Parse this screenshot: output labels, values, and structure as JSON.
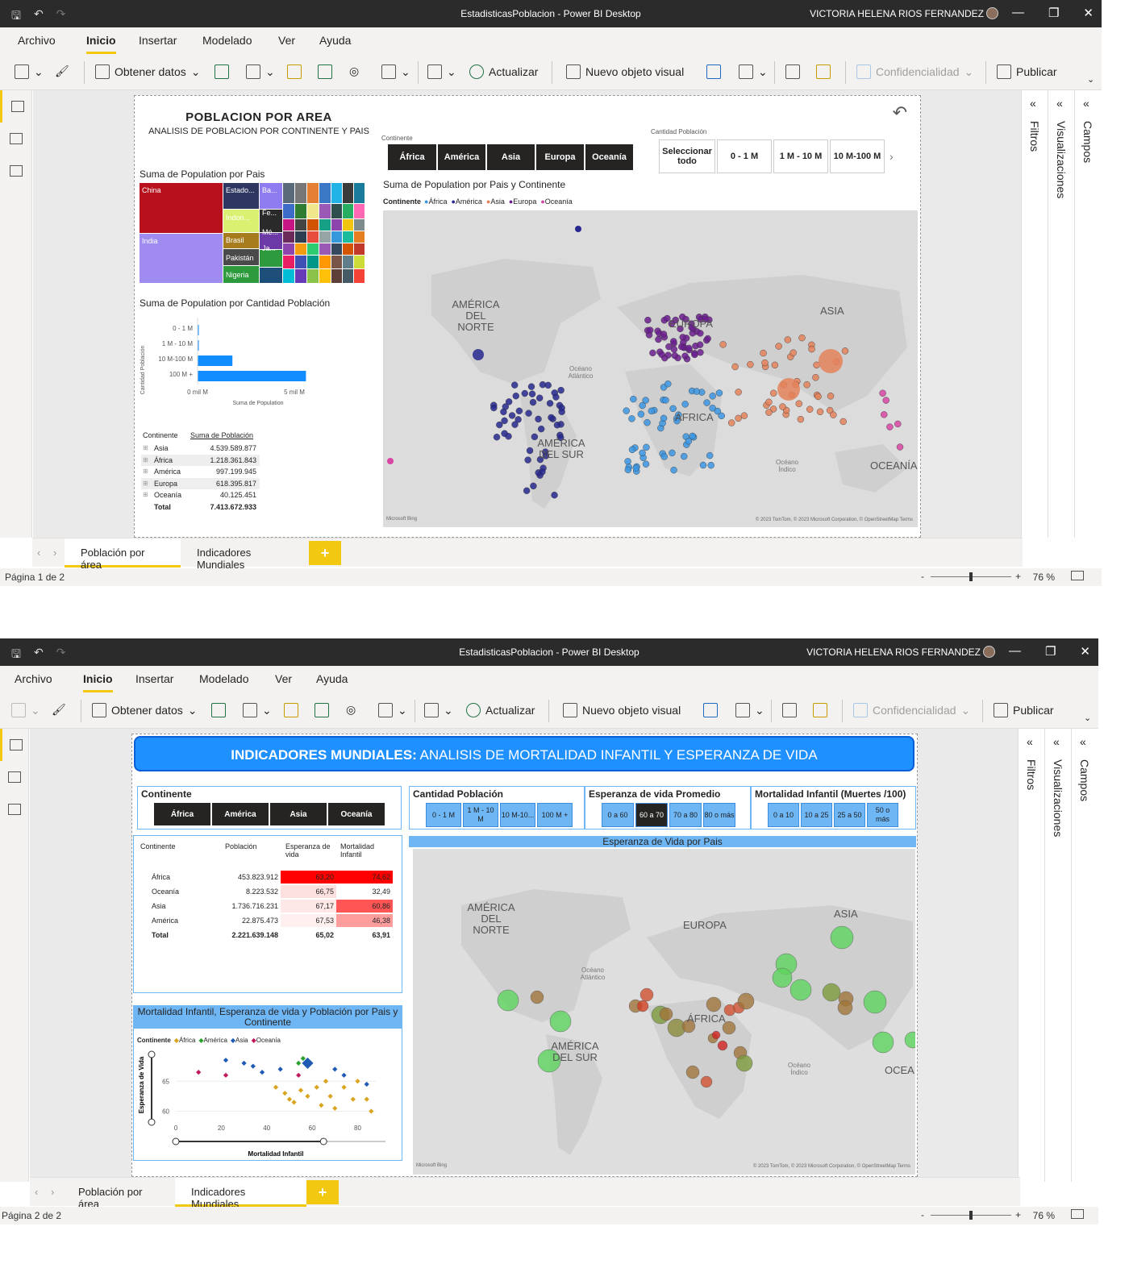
{
  "app": {
    "title": "EstadisticasPoblacion - Power BI Desktop",
    "user": "VICTORIA HELENA RIOS FERNANDEZ",
    "menu": [
      "Archivo",
      "Inicio",
      "Insertar",
      "Modelado",
      "Ver",
      "Ayuda"
    ],
    "ribbon": {
      "obtener": "Obtener datos",
      "actualizar": "Actualizar",
      "nuevo": "Nuevo objeto visual",
      "confidencialidad": "Confidencialidad",
      "publicar": "Publicar"
    },
    "panes": [
      "Filtros",
      "Visualizaciones",
      "Campos"
    ],
    "tabs": [
      "Población por área",
      "Indicadores Mundiales"
    ],
    "zoom": "76 %"
  },
  "page1": {
    "status": "Página 1 de 2",
    "title": "POBLACION POR AREA",
    "subtitle": "ANALISIS DE POBLACION POR CONTINENTE Y PAIS",
    "continent_slicer_label": "Continente",
    "continents": [
      "África",
      "América",
      "Asia",
      "Europa",
      "Oceanía"
    ],
    "cantidad_slicer_label": "Cantidad Población",
    "cantidad_options": [
      "Seleccionar todo",
      "0 - 1 M",
      "1 M - 10 M",
      "10 M-100 M"
    ],
    "treemap_title": "Suma de Population por Pais",
    "treemap_labels": [
      "China",
      "India",
      "Estado...",
      "Ba...",
      "Indon...",
      "Fe...",
      "Brasil",
      "Mé...",
      "Pakistán",
      "Ja...",
      "Nigeria"
    ],
    "bar_title": "Suma de Population por Cantidad Población",
    "bar_ylabel": "Cantidad Población",
    "bar_xlabel": "Suma de Population",
    "bar_ticks": [
      "0 mil M",
      "5 mil M"
    ],
    "map_title": "Suma de Population por Pais y Continente",
    "map_legend_label": "Continente",
    "map_labels": [
      "AMÉRICA DEL NORTE",
      "EUROPA",
      "ASIA",
      "ÁFRICA",
      "AMÉRICA DEL SUR",
      "OCEANÍA",
      "Océano Atlántico",
      "Océano Índico"
    ],
    "map_credit": "© 2023 TomTom, © 2023 Microsoft Corporation, © OpenStreetMap  Terms",
    "bing": "Microsoft Bing",
    "table_headers": [
      "Continente",
      "Suma de Población"
    ],
    "table_rows": [
      [
        "Asia",
        "4.539.589.877"
      ],
      [
        "África",
        "1.218.361.843"
      ],
      [
        "América",
        "997.199.945"
      ],
      [
        "Europa",
        "618.395.817"
      ],
      [
        "Oceanía",
        "40.125.451"
      ]
    ],
    "table_total": [
      "Total",
      "7.413.672.933"
    ]
  },
  "page2": {
    "status": "Página 2 de 2",
    "banner_bold": "INDICADORES MUNDIALES:",
    "banner_rest": " ANALISIS DE MORTALIDAD INFANTIL Y ESPERANZA DE VIDA",
    "continent_label": "Continente",
    "continents": [
      "África",
      "América",
      "Asia",
      "Oceanía"
    ],
    "cantidad_label": "Cantidad Población",
    "cantidad_options": [
      "0 - 1 M",
      "1 M - 10 M",
      "10 M-10...",
      "100 M +"
    ],
    "esperanza_label": "Esperanza de vida Promedio",
    "esperanza_options": [
      "0 a 60",
      "60 a 70",
      "70 a 80",
      "80 o más"
    ],
    "mortalidad_label": "Mortalidad Infantil (Muertes /100)",
    "mortalidad_options": [
      "0 a 10",
      "10 a 25",
      "25 a 50",
      "50 o más"
    ],
    "table_headers": [
      "Continente",
      "Población",
      "Esperanza de vida",
      "Mortalidad Infantil"
    ],
    "table_rows": [
      [
        "África",
        "453.823.912",
        "63,20",
        "74,62"
      ],
      [
        "Oceanía",
        "8.223.532",
        "66,75",
        "32,49"
      ],
      [
        "Asia",
        "1.736.716.231",
        "67,17",
        "60,86"
      ],
      [
        "América",
        "22.875.473",
        "67,53",
        "46,38"
      ]
    ],
    "table_total": [
      "Total",
      "2.221.639.148",
      "65,02",
      "63,91"
    ],
    "map_title": "Esperanza de Vida por Pais",
    "map_labels": [
      "AMÉRICA DEL NORTE",
      "EUROPA",
      "ASIA",
      "ÁFRICA",
      "AMÉRICA DEL SUR",
      "OCEA",
      "Océano Atlántico",
      "Océano Índico"
    ],
    "scatter_title": "Mortalidad Infantil, Esperanza de vida y Población por Pais y Continente",
    "scatter_legend_label": "Continente",
    "scatter_legend": [
      "África",
      "América",
      "Asia",
      "Oceanía"
    ],
    "scatter_xlabel": "Mortalidad Infantil",
    "scatter_ylabel": "Esperanza de Vida",
    "scatter_xticks": [
      "0",
      "20",
      "40",
      "60",
      "80"
    ],
    "scatter_yticks": [
      "65",
      "60"
    ]
  },
  "colors": {
    "africa": "#3b97e3",
    "america": "#27288f",
    "asia": "#e4825a",
    "europa": "#6b1f8f",
    "oceania": "#d846a3",
    "bar": "#118dff",
    "accent": "#f2c811"
  },
  "chart_data": [
    {
      "type": "bar",
      "title": "Suma de Population por Cantidad Población",
      "orientation": "horizontal",
      "categories": [
        "0 - 1 M",
        "1 M - 10 M",
        "10 M-100 M",
        "100 M +"
      ],
      "values": [
        0.002,
        0.05,
        1.8,
        5.6
      ],
      "unit": "mil M",
      "xlabel": "Suma de Population",
      "ylabel": "Cantidad Población",
      "xlim": [
        0,
        7.5
      ]
    },
    {
      "type": "scatter",
      "title": "Mortalidad Infantil, Esperanza de vida y Población por Pais y Continente",
      "xlabel": "Mortalidad Infantil",
      "ylabel": "Esperanza de Vida",
      "xlim": [
        0,
        88
      ],
      "ylim": [
        59,
        70
      ],
      "series": [
        {
          "name": "África",
          "points": [
            [
              44,
              64
            ],
            [
              48,
              63
            ],
            [
              50,
              62
            ],
            [
              52,
              61.5
            ],
            [
              55,
              63.5
            ],
            [
              58,
              62.5
            ],
            [
              62,
              64
            ],
            [
              64,
              61
            ],
            [
              66,
              65
            ],
            [
              68,
              62.5
            ],
            [
              70,
              60.5
            ],
            [
              74,
              64
            ],
            [
              78,
              62
            ],
            [
              80,
              65
            ],
            [
              84,
              62
            ],
            [
              86,
              60
            ]
          ]
        },
        {
          "name": "América",
          "points": [
            [
              54,
              68
            ],
            [
              56,
              68.8
            ]
          ]
        },
        {
          "name": "Asia",
          "points": [
            [
              22,
              68.5
            ],
            [
              30,
              68
            ],
            [
              34,
              67.5
            ],
            [
              38,
              66.5
            ],
            [
              46,
              67
            ],
            [
              58,
              68
            ],
            [
              70,
              67
            ],
            [
              74,
              66
            ],
            [
              84,
              64.5
            ]
          ]
        },
        {
          "name": "Oceanía",
          "points": [
            [
              10,
              66.5
            ],
            [
              22,
              66
            ],
            [
              54,
              66
            ]
          ]
        }
      ]
    }
  ]
}
